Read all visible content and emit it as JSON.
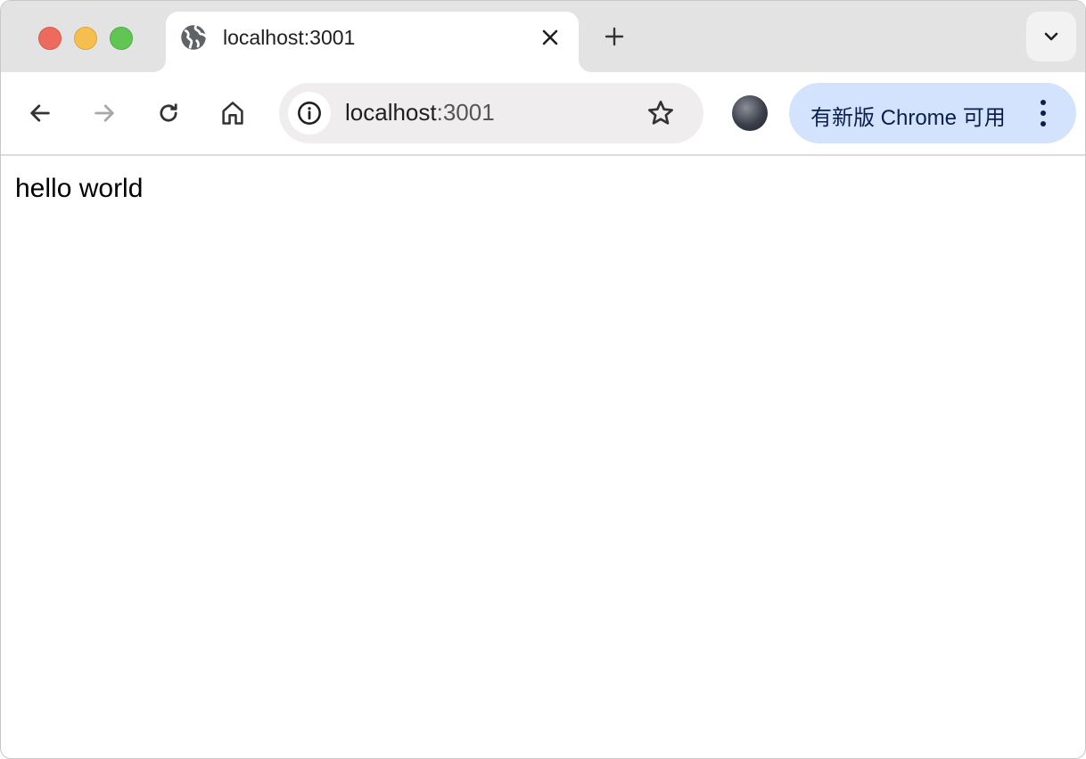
{
  "window": {
    "traffic_lights": {
      "close": "#ed6a5e",
      "minimize": "#f5bf4f",
      "zoom": "#61c554"
    }
  },
  "tab": {
    "title": "localhost:3001",
    "icon": "globe-icon"
  },
  "toolbar": {
    "address_host": "localhost",
    "address_port": ":3001",
    "update_label": "有新版 Chrome 可用"
  },
  "colors": {
    "update_pill": "#d3e3fd",
    "omnibox": "#efeded",
    "tabstrip": "#e3e3e3"
  },
  "page": {
    "text": "hello world"
  }
}
